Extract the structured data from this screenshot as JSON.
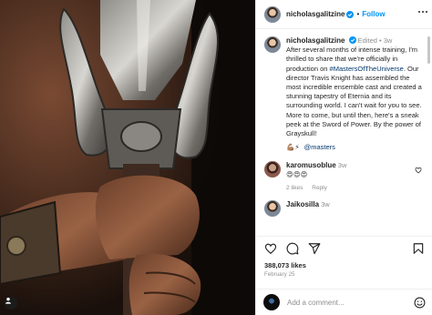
{
  "post": {
    "username": "nicholasgalitzine",
    "follow_label": "Follow",
    "separator": "•",
    "edited_label": "Edited",
    "age": "3w",
    "caption_text": "After several months of intense training, I'm thrilled to share that we're officially in production on ",
    "hashtag": "#MastersOfTheUniverse",
    "caption_text_2": ". Our director Travis Knight has assembled the most incredible ensemble cast and created a stunning tapestry of Eternia and its surrounding world. I can't wait for you to see. More to come, but until then, here's a sneak peek at the Sword of Power. By the power of Grayskull!",
    "emoji_line": "💪🏽⚡",
    "mention": "@masters",
    "likes": "388,073 likes",
    "date": "February 25"
  },
  "comments": [
    {
      "username": "karomusoblue",
      "age": "3w",
      "text": "😍😍😍",
      "likes": "2 likes",
      "reply_label": "Reply"
    }
  ],
  "partial_comment": {
    "username": "Jaikosilla",
    "age": "3w"
  },
  "add_comment": {
    "placeholder": "Add a comment..."
  },
  "icons": {
    "media_user": "user-icon",
    "verified": "verified-badge-icon",
    "like": "heart-icon",
    "comment": "comment-icon",
    "share": "send-icon",
    "save": "bookmark-icon",
    "emoji": "smiley-icon",
    "more": "more-options-icon"
  },
  "colors": {
    "link_blue": "#0095f6",
    "hashtag": "#00376b",
    "muted": "#8e8e8e"
  }
}
